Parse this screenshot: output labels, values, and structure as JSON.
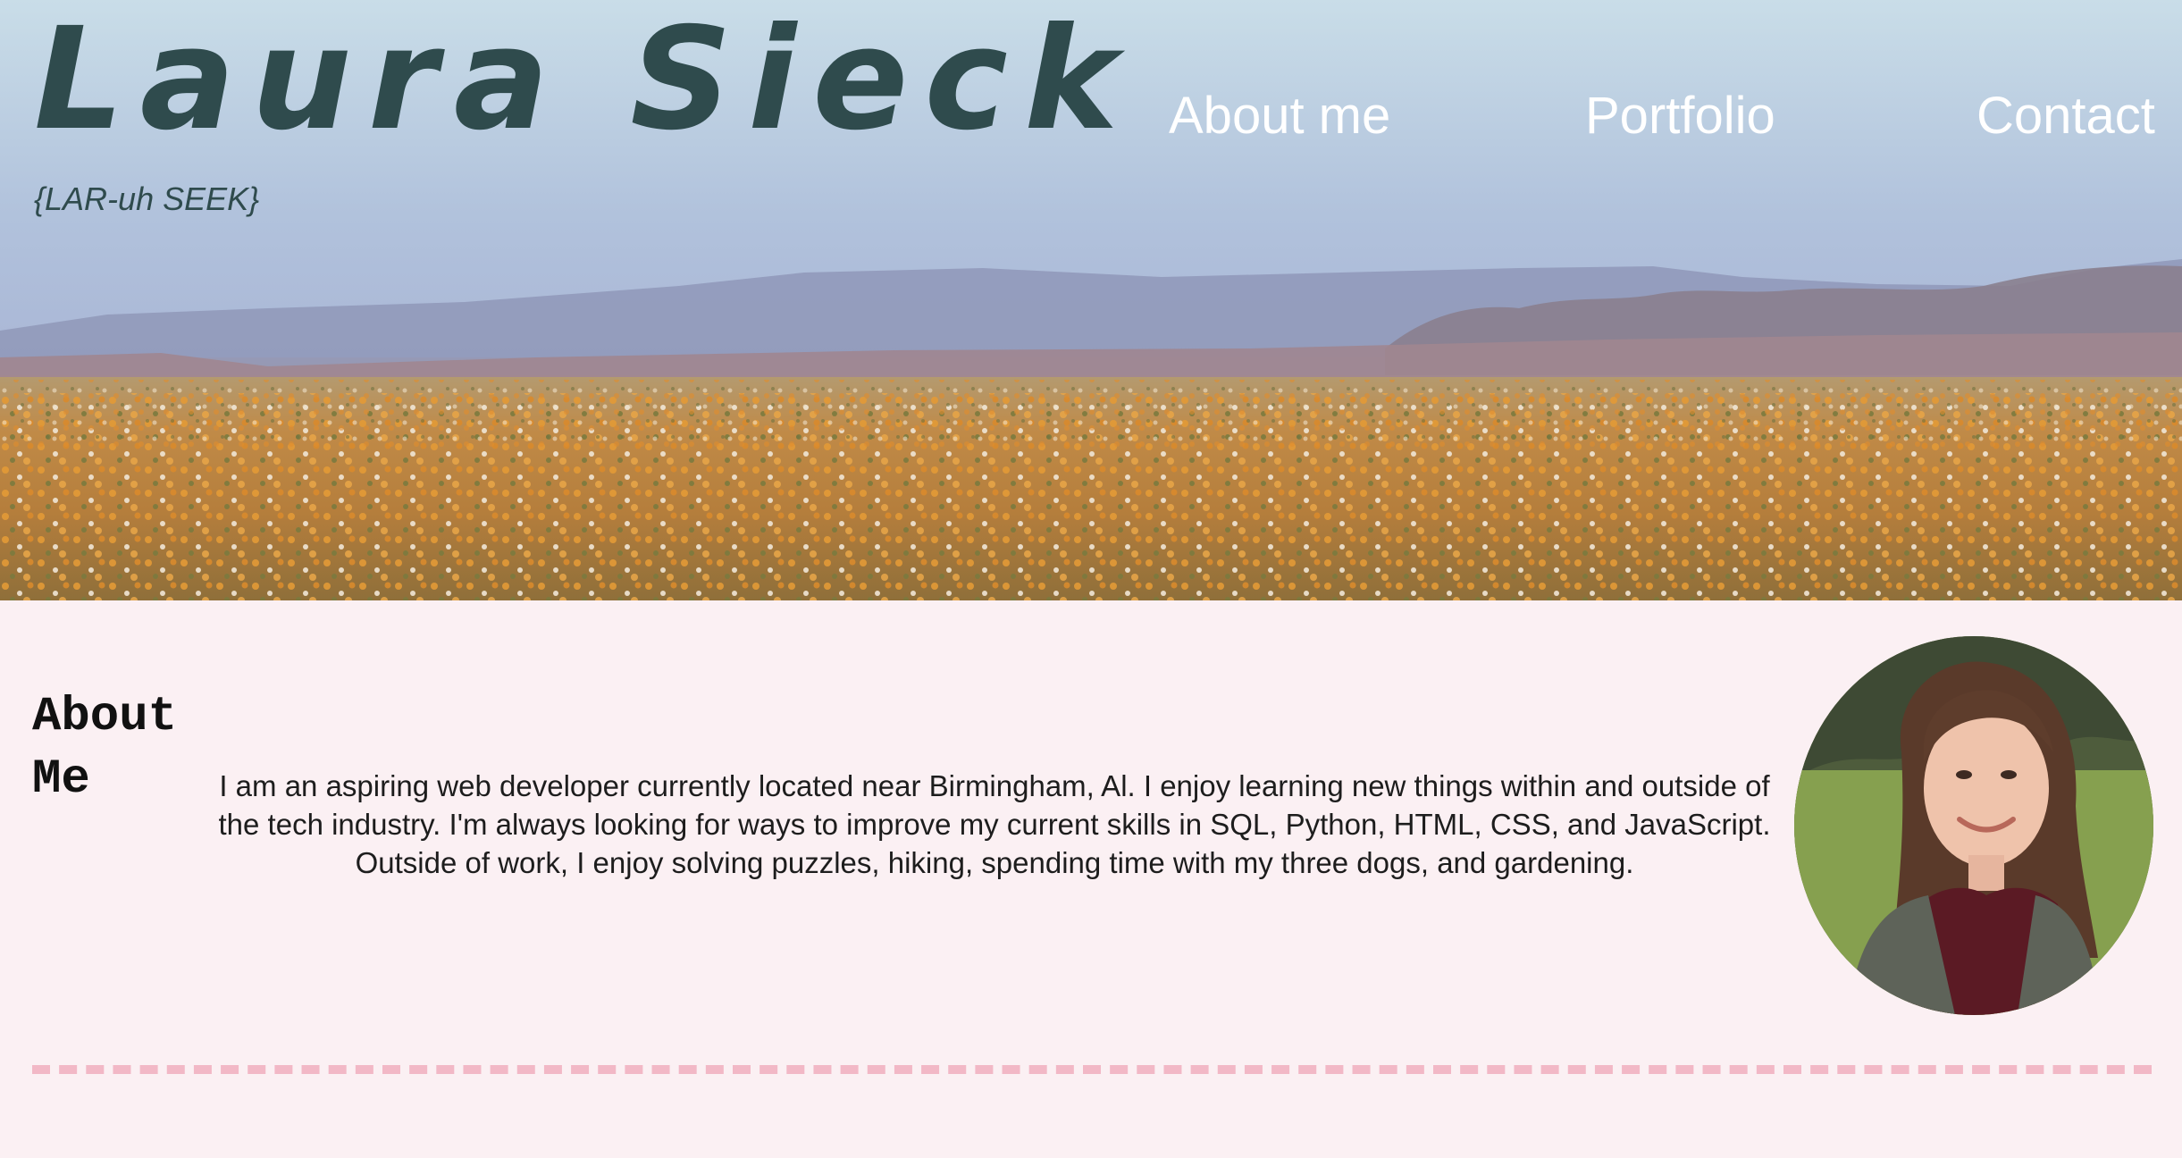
{
  "header": {
    "title": "Laura Sieck",
    "pronunciation": "{LAR-uh SEEK}",
    "nav": {
      "about": "About me",
      "portfolio": "Portfolio",
      "contact": "Contact"
    }
  },
  "about": {
    "heading": "About Me",
    "paragraph": "I am an aspiring web developer currently located near Birmingham, Al. I enjoy learning new things within and outside of the tech industry. I'm always looking for ways to improve my current skills in SQL, Python, HTML, CSS, and JavaScript. Outside of work, I enjoy solving puzzles, hiking, spending time with my three dogs, and gardening."
  },
  "colors": {
    "title": "#2f4b4d",
    "nav_text": "#ffffff",
    "page_background": "#fbf0f3",
    "divider": "#f2b8c6"
  }
}
